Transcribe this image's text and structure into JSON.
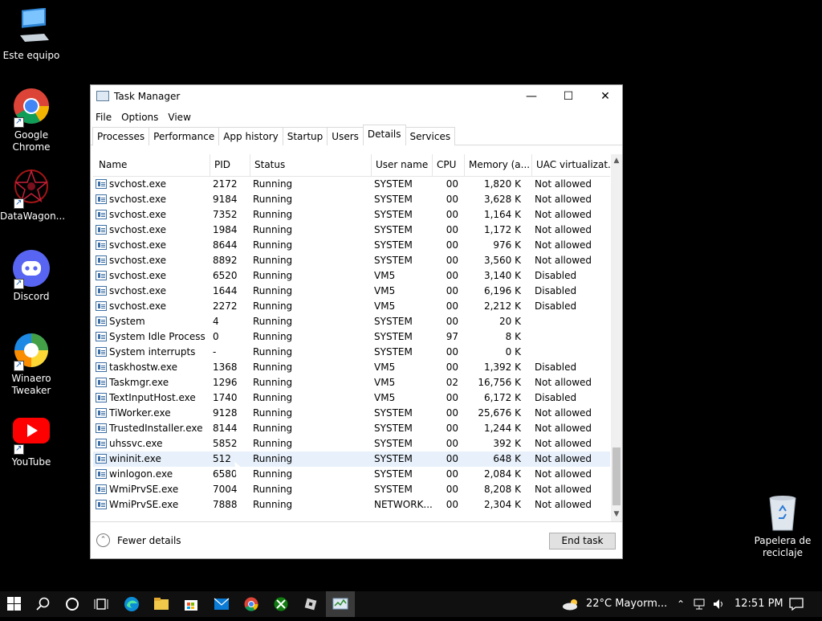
{
  "desktop": {
    "icons": [
      {
        "label_lines": [
          "Este equipo"
        ],
        "icon": "computer-icon"
      },
      {
        "label_lines": [
          "Google",
          "Chrome"
        ],
        "icon": "chrome-icon"
      },
      {
        "label_lines": [
          "DataWagon..."
        ],
        "icon": "datawagon-icon"
      },
      {
        "label_lines": [
          "Discord"
        ],
        "icon": "discord-icon"
      },
      {
        "label_lines": [
          "Winaero",
          "Tweaker"
        ],
        "icon": "winaero-icon"
      },
      {
        "label_lines": [
          "YouTube"
        ],
        "icon": "youtube-icon"
      },
      {
        "label_lines": [
          "Papelera de",
          "reciclaje"
        ],
        "icon": "recycle-bin-icon"
      }
    ]
  },
  "window": {
    "title": "Task Manager",
    "controls": {
      "minimize": "—",
      "maximize": "☐",
      "close": "✕"
    },
    "menu": [
      "File",
      "Options",
      "View"
    ],
    "tabs": [
      "Processes",
      "Performance",
      "App history",
      "Startup",
      "Users",
      "Details",
      "Services"
    ],
    "active_tab": "Details",
    "columns": [
      "Name",
      "PID",
      "Status",
      "User name",
      "CPU",
      "Memory (a...",
      "UAC virtualizat..."
    ],
    "sort_arrow": "˄",
    "rows": [
      {
        "name": "svchost.exe",
        "pid": "2172",
        "status": "Running",
        "user": "SYSTEM",
        "cpu": "00",
        "mem": "1,820 K",
        "uac": "Not allowed"
      },
      {
        "name": "svchost.exe",
        "pid": "9184",
        "status": "Running",
        "user": "SYSTEM",
        "cpu": "00",
        "mem": "3,628 K",
        "uac": "Not allowed"
      },
      {
        "name": "svchost.exe",
        "pid": "7352",
        "status": "Running",
        "user": "SYSTEM",
        "cpu": "00",
        "mem": "1,164 K",
        "uac": "Not allowed"
      },
      {
        "name": "svchost.exe",
        "pid": "1984",
        "status": "Running",
        "user": "SYSTEM",
        "cpu": "00",
        "mem": "1,172 K",
        "uac": "Not allowed"
      },
      {
        "name": "svchost.exe",
        "pid": "8644",
        "status": "Running",
        "user": "SYSTEM",
        "cpu": "00",
        "mem": "976 K",
        "uac": "Not allowed"
      },
      {
        "name": "svchost.exe",
        "pid": "8892",
        "status": "Running",
        "user": "SYSTEM",
        "cpu": "00",
        "mem": "3,560 K",
        "uac": "Not allowed"
      },
      {
        "name": "svchost.exe",
        "pid": "6520",
        "status": "Running",
        "user": "VM5",
        "cpu": "00",
        "mem": "3,140 K",
        "uac": "Disabled"
      },
      {
        "name": "svchost.exe",
        "pid": "1644",
        "status": "Running",
        "user": "VM5",
        "cpu": "00",
        "mem": "6,196 K",
        "uac": "Disabled"
      },
      {
        "name": "svchost.exe",
        "pid": "2272",
        "status": "Running",
        "user": "VM5",
        "cpu": "00",
        "mem": "2,212 K",
        "uac": "Disabled"
      },
      {
        "name": "System",
        "pid": "4",
        "status": "Running",
        "user": "SYSTEM",
        "cpu": "00",
        "mem": "20 K",
        "uac": ""
      },
      {
        "name": "System Idle Process",
        "pid": "0",
        "status": "Running",
        "user": "SYSTEM",
        "cpu": "97",
        "mem": "8 K",
        "uac": ""
      },
      {
        "name": "System interrupts",
        "pid": "-",
        "status": "Running",
        "user": "SYSTEM",
        "cpu": "00",
        "mem": "0 K",
        "uac": ""
      },
      {
        "name": "taskhostw.exe",
        "pid": "1368",
        "status": "Running",
        "user": "VM5",
        "cpu": "00",
        "mem": "1,392 K",
        "uac": "Disabled"
      },
      {
        "name": "Taskmgr.exe",
        "pid": "1296",
        "status": "Running",
        "user": "VM5",
        "cpu": "02",
        "mem": "16,756 K",
        "uac": "Not allowed"
      },
      {
        "name": "TextInputHost.exe",
        "pid": "1740",
        "status": "Running",
        "user": "VM5",
        "cpu": "00",
        "mem": "6,172 K",
        "uac": "Disabled"
      },
      {
        "name": "TiWorker.exe",
        "pid": "9128",
        "status": "Running",
        "user": "SYSTEM",
        "cpu": "00",
        "mem": "25,676 K",
        "uac": "Not allowed"
      },
      {
        "name": "TrustedInstaller.exe",
        "pid": "8144",
        "status": "Running",
        "user": "SYSTEM",
        "cpu": "00",
        "mem": "1,244 K",
        "uac": "Not allowed"
      },
      {
        "name": "uhssvc.exe",
        "pid": "5852",
        "status": "Running",
        "user": "SYSTEM",
        "cpu": "00",
        "mem": "392 K",
        "uac": "Not allowed"
      },
      {
        "name": "wininit.exe",
        "pid": "512",
        "status": "Running",
        "user": "SYSTEM",
        "cpu": "00",
        "mem": "648 K",
        "uac": "Not allowed"
      },
      {
        "name": "winlogon.exe",
        "pid": "6580",
        "status": "Running",
        "user": "SYSTEM",
        "cpu": "00",
        "mem": "2,084 K",
        "uac": "Not allowed"
      },
      {
        "name": "WmiPrvSE.exe",
        "pid": "7004",
        "status": "Running",
        "user": "SYSTEM",
        "cpu": "00",
        "mem": "8,208 K",
        "uac": "Not allowed"
      },
      {
        "name": "WmiPrvSE.exe",
        "pid": "7888",
        "status": "Running",
        "user": "NETWORK...",
        "cpu": "00",
        "mem": "2,304 K",
        "uac": "Not allowed"
      }
    ],
    "highlighted_row": "wininit.exe",
    "fewer_details": "Fewer details",
    "end_task": "End task"
  },
  "taskbar": {
    "weather": "22°C  Mayorm...",
    "clock": "12:51 PM"
  },
  "colors": {
    "desktop": "#000000",
    "taskbar": "#101010",
    "row_highlight": "#e8f1fb"
  }
}
